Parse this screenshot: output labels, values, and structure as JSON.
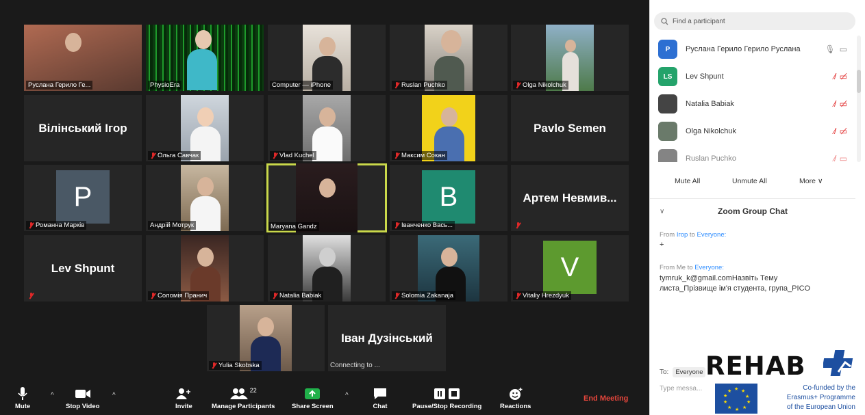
{
  "participants_grid": {
    "row1": [
      {
        "name": "Руслана Герило Ге...",
        "muted": false
      },
      {
        "name": "PhysioEra",
        "muted": false
      },
      {
        "name": "Computer — iPhone",
        "muted": false
      },
      {
        "name": "Ruslan Puchko",
        "muted": true
      },
      {
        "name": "Olga Nikolchuk",
        "muted": true
      }
    ],
    "row2": [
      {
        "big_name": "Вілінський Ігор",
        "name": "",
        "muted": false
      },
      {
        "name": "Ольга Савчак",
        "muted": true
      },
      {
        "name": "Vlad Kuchel",
        "muted": true
      },
      {
        "name": "Максим Сокан",
        "muted": true
      },
      {
        "big_name": "Pavlo Semen",
        "name": "",
        "muted": false
      }
    ],
    "row3": [
      {
        "letter": "P",
        "name": "Романна Марків",
        "muted": true,
        "letter_bg": "#4a5865"
      },
      {
        "name": "Андрій Мотрук",
        "muted": false
      },
      {
        "name": "Maryana Gandz",
        "muted": false,
        "active": true
      },
      {
        "letter": "B",
        "name": "Іванченко Вась...",
        "muted": true,
        "letter_bg": "#1f8a70"
      },
      {
        "big_name": "Артем Невмив...",
        "name": "",
        "muted": true
      }
    ],
    "row4": [
      {
        "big_name": "Lev Shpunt",
        "name": "",
        "muted": true
      },
      {
        "name": "Соломія Пранич",
        "muted": true
      },
      {
        "name": "Natalia Babiak",
        "muted": true
      },
      {
        "name": "Solomia Zakanaja",
        "muted": true
      },
      {
        "letter": "V",
        "name": "Vitaliy Hrezdyuk",
        "muted": true,
        "letter_bg": "#5d9a2f"
      }
    ],
    "row5": [
      {
        "name": "Yulia Skobska",
        "muted": true
      },
      {
        "big_name": "Іван Дузінський",
        "connecting": "Connecting to ...",
        "name": "",
        "muted": false
      }
    ]
  },
  "toolbar": {
    "mute": "Mute",
    "stop_video": "Stop Video",
    "invite": "Invite",
    "manage_participants": "Manage Participants",
    "participant_count": "22",
    "share_screen": "Share Screen",
    "chat": "Chat",
    "recording": "Pause/Stop Recording",
    "reactions": "Reactions",
    "end_meeting": "End Meeting",
    "colors": {
      "end": "#e8463c",
      "share": "#20b14a"
    }
  },
  "panel": {
    "search_placeholder": "Find a participant",
    "participants": [
      {
        "initials": "P",
        "avatar_bg": "#2d6fd2",
        "name": "Руслана Герило Герило Руслана"
      },
      {
        "initials": "LS",
        "avatar_bg": "#24a36b",
        "name": "Lev Shpunt"
      },
      {
        "initials": "",
        "avatar_bg": "#444",
        "name": "Natalia Babiak"
      },
      {
        "initials": "",
        "avatar_bg": "#6a7a6a",
        "name": "Olga Nikolchuk"
      },
      {
        "initials": "",
        "avatar_bg": "#333",
        "name": "Ruslan Puchko"
      }
    ],
    "mute_all": "Mute All",
    "unmute_all": "Unmute All",
    "more": "More ∨",
    "chat_title": "Zoom Group Chat",
    "messages": [
      {
        "from": "From ",
        "sender": "Ігор",
        "to_word": " to ",
        "to": "Everyone:",
        "text": "+"
      },
      {
        "from": "From Me to ",
        "sender": "",
        "to_word": "",
        "to": "Everyone:",
        "text": "tymruk_k@gmail.comНазвіть Тему листа_Прізвище ім'я студента, група_PICO"
      }
    ],
    "to_label": "To:",
    "to_value": "Everyone",
    "type_placeholder": "Type messa..."
  },
  "logo": {
    "word": "REHAB",
    "cofund_line1": "Co-funded by the",
    "cofund_line2": "Erasmus+ Programme",
    "cofund_line3": "of the European Union"
  }
}
